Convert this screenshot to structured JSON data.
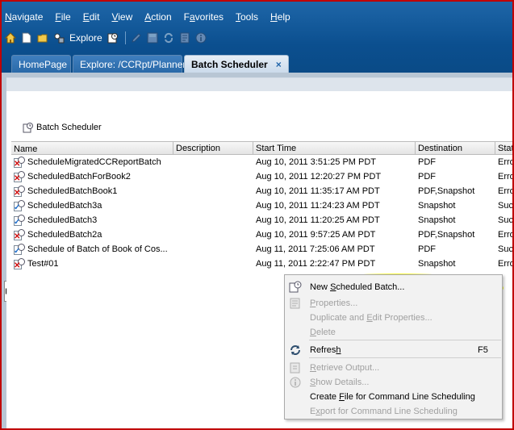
{
  "menubar": [
    {
      "label": "Navigate",
      "mnemonic": "N"
    },
    {
      "label": "File",
      "mnemonic": "F"
    },
    {
      "label": "Edit",
      "mnemonic": "E"
    },
    {
      "label": "View",
      "mnemonic": "V"
    },
    {
      "label": "Action",
      "mnemonic": "A"
    },
    {
      "label": "Favorites",
      "mnemonic": "a"
    },
    {
      "label": "Tools",
      "mnemonic": "T"
    },
    {
      "label": "Help",
      "mnemonic": "H"
    }
  ],
  "toolbar": {
    "explore_label": "Explore",
    "icons": [
      "home-icon",
      "new-document-icon",
      "open-folder-icon",
      "explore-icon",
      "batch-scheduler-icon",
      "edit-icon",
      "save-icon",
      "refresh-icon",
      "properties-icon",
      "info-icon"
    ]
  },
  "tabs": [
    {
      "label": "HomePage",
      "active": false
    },
    {
      "label": "Explore: /CCRpt/Planner",
      "active": false
    },
    {
      "label": "Batch Scheduler",
      "active": true,
      "close": "×"
    }
  ],
  "pane": {
    "title": "Batch Scheduler"
  },
  "table": {
    "columns": [
      "Name",
      "Description",
      "Start Time",
      "Destination",
      "Stat"
    ],
    "rows": [
      {
        "status_icon": "error",
        "name": "ScheduleMigratedCCReportBatch",
        "description": "",
        "start": "Aug 10, 2011 3:51:25 PM PDT",
        "dest": "PDF",
        "status": "Erro"
      },
      {
        "status_icon": "error",
        "name": "ScheduledBatchForBook2",
        "description": "",
        "start": "Aug 10, 2011 12:20:27 PM PDT",
        "dest": "PDF",
        "status": "Erro"
      },
      {
        "status_icon": "error",
        "name": "ScheduledBatchBook1",
        "description": "",
        "start": "Aug 10, 2011 11:35:17 AM PDT",
        "dest": "PDF,Snapshot",
        "status": "Erro"
      },
      {
        "status_icon": "ok",
        "name": "ScheduledBatch3a",
        "description": "",
        "start": "Aug 10, 2011 11:24:23 AM PDT",
        "dest": "Snapshot",
        "status": "Suc"
      },
      {
        "status_icon": "ok",
        "name": "ScheduledBatch3",
        "description": "",
        "start": "Aug 10, 2011 11:20:25 AM PDT",
        "dest": "Snapshot",
        "status": "Suc"
      },
      {
        "status_icon": "error",
        "name": "ScheduledBatch2a",
        "description": "",
        "start": "Aug 10, 2011 9:57:25 AM PDT",
        "dest": "PDF,Snapshot",
        "status": "Erro"
      },
      {
        "status_icon": "ok",
        "name": "Schedule of Batch of Book of Cos...",
        "description": "",
        "start": "Aug 11, 2011 7:25:06 AM PDT",
        "dest": "PDF",
        "status": "Suc"
      },
      {
        "status_icon": "error",
        "name": "Test#01",
        "description": "",
        "start": "Aug 11, 2011 2:22:47 PM PDT",
        "dest": "Snapshot",
        "status": "Erro"
      }
    ]
  },
  "context_menu": {
    "items": [
      {
        "label": "New Scheduled Batch...",
        "mnemonic": "S",
        "enabled": true,
        "icon": "new-batch-icon",
        "shortcut": ""
      },
      {
        "label": "Properties...",
        "mnemonic": "P",
        "enabled": false,
        "icon": "properties-icon",
        "shortcut": ""
      },
      {
        "label": "Duplicate and Edit Properties...",
        "mnemonic": "E",
        "enabled": false,
        "icon": "",
        "shortcut": ""
      },
      {
        "label": "Delete",
        "mnemonic": "D",
        "enabled": false,
        "icon": "",
        "shortcut": ""
      },
      {
        "label": "Refresh",
        "mnemonic": "h",
        "enabled": true,
        "icon": "refresh-icon",
        "shortcut": "F5"
      },
      {
        "label": "Retrieve Output...",
        "mnemonic": "R",
        "enabled": false,
        "icon": "retrieve-output-icon",
        "shortcut": ""
      },
      {
        "label": "Show Details...",
        "mnemonic": "S",
        "enabled": false,
        "icon": "info-icon",
        "shortcut": ""
      },
      {
        "label": "Create File for Command Line Scheduling",
        "mnemonic": "F",
        "enabled": true,
        "icon": "",
        "shortcut": ""
      },
      {
        "label": "Export for Command Line Scheduling",
        "mnemonic": "x",
        "enabled": false,
        "icon": "",
        "shortcut": ""
      }
    ]
  },
  "colors": {
    "header_blue": "#0b4f8f",
    "window_border": "#c00000",
    "highlight": "#fbff2e",
    "error_red": "#d01010",
    "ok_blue": "#1a6bc9"
  }
}
